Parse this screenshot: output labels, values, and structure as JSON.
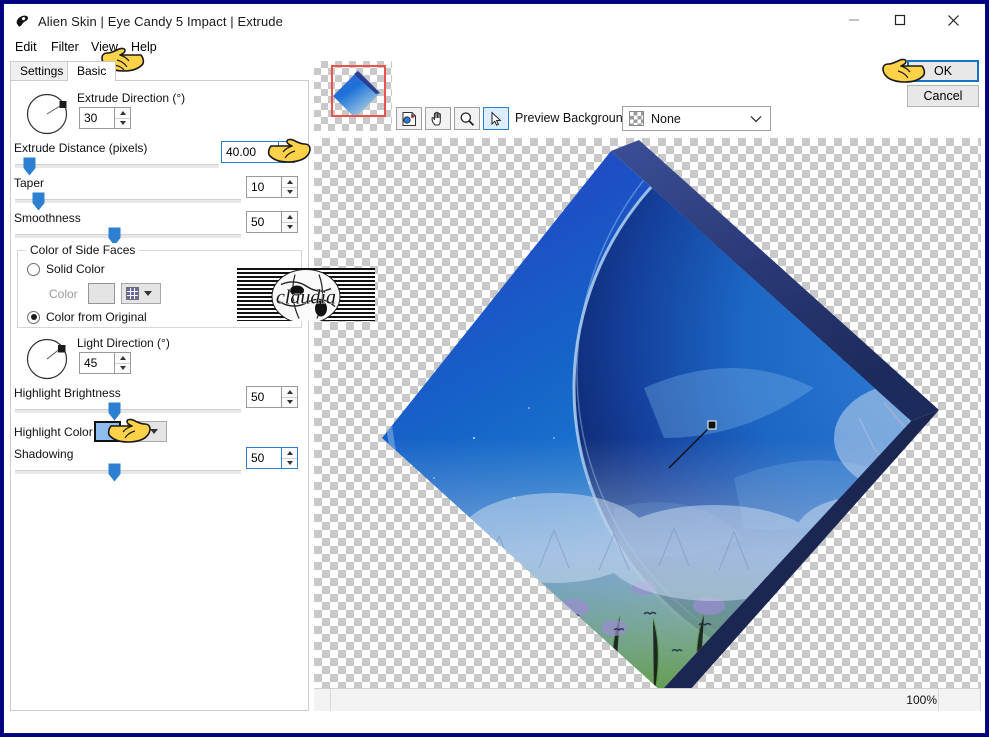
{
  "window": {
    "title": "Alien Skin | Eye Candy 5 Impact | Extrude",
    "app_icon": "alien-skin-icon",
    "controls": {
      "minimize": "–",
      "maximize": "□",
      "close": "✕"
    }
  },
  "menu": {
    "items": [
      "Edit",
      "Filter",
      "View",
      "Help"
    ]
  },
  "tabs": {
    "items": [
      "Settings",
      "Basic"
    ],
    "active": "Basic"
  },
  "settings": {
    "extrude_direction": {
      "label": "Extrude Direction (°)",
      "value": "30",
      "dial_angle_deg": 30
    },
    "extrude_distance": {
      "label": "Extrude Distance (pixels)",
      "value": "40.00",
      "slider_percent": 7,
      "focused": true
    },
    "taper": {
      "label": "Taper",
      "value": "10",
      "slider_percent": 10
    },
    "smoothness": {
      "label": "Smoothness",
      "value": "50",
      "slider_percent": 44
    },
    "side_faces": {
      "group_label": "Color of Side Faces",
      "solid_color": {
        "label": "Solid Color",
        "selected": false
      },
      "color_label": "Color",
      "color_swatch": "#e4e4e4",
      "color_from_original": {
        "label": "Color from Original",
        "selected": true
      }
    },
    "light_direction": {
      "label": "Light Direction (°)",
      "value": "45",
      "dial_angle_deg": 45
    },
    "highlight_brightness": {
      "label": "Highlight Brightness",
      "value": "50",
      "slider_percent": 44
    },
    "highlight_color": {
      "label": "Highlight Color",
      "swatch": "#8ebcec"
    },
    "shadowing": {
      "label": "Shadowing",
      "value": "50",
      "slider_percent": 44,
      "focused": true
    }
  },
  "preview_toolbar": {
    "tools": [
      {
        "name": "navigator-icon",
        "selected": false
      },
      {
        "name": "pan-hand-icon",
        "selected": false
      },
      {
        "name": "zoom-magnifier-icon",
        "selected": false
      },
      {
        "name": "arrow-select-icon",
        "selected": true
      }
    ],
    "preview_background_label": "Preview Background:",
    "preview_background_value": "None"
  },
  "dialog_buttons": {
    "ok": "OK",
    "cancel": "Cancel"
  },
  "statusbar": {
    "zoom": "100%"
  },
  "watermark": {
    "text": "claudia"
  },
  "colors": {
    "accent_blue": "#2a7fd4",
    "slider_thumb": "#2d7fd2",
    "selection_red": "#e8534a",
    "titlebar_bg": "#ffffff",
    "window_border": "#000080"
  },
  "preview_image": {
    "description": "winter landscape with planet earth, extruded diamond shape",
    "rotation_deg": 45,
    "light_indicator": "diagonal line with square handle"
  }
}
